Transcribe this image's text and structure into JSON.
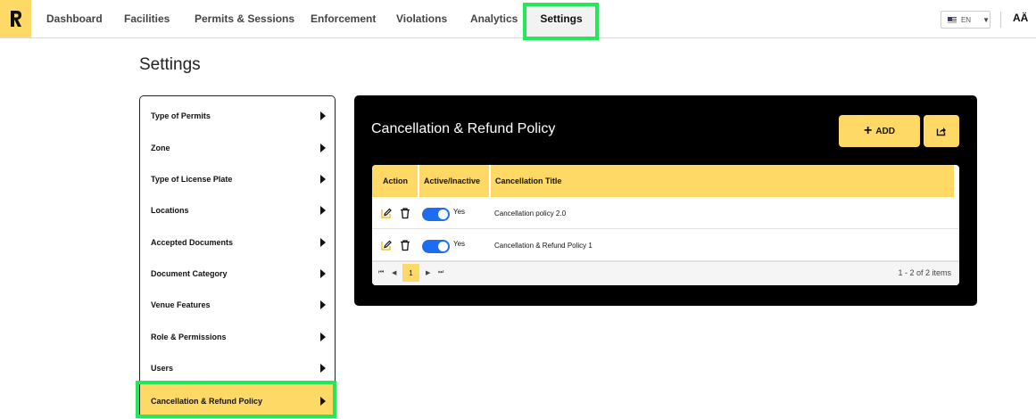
{
  "nav": {
    "items": [
      {
        "label": "Dashboard"
      },
      {
        "label": "Facilities"
      },
      {
        "label": "Permits & Sessions"
      },
      {
        "label": "Enforcement"
      },
      {
        "label": "Violations"
      },
      {
        "label": "Analytics"
      },
      {
        "label": "Settings",
        "active": true
      }
    ],
    "language": "EN",
    "font_size_label": "AÄ"
  },
  "page": {
    "title": "Settings"
  },
  "sidebar": {
    "items": [
      {
        "label": "Type of Permits"
      },
      {
        "label": "Zone"
      },
      {
        "label": "Type of License Plate"
      },
      {
        "label": "Locations"
      },
      {
        "label": "Accepted Documents"
      },
      {
        "label": "Document Category"
      },
      {
        "label": "Venue Features"
      },
      {
        "label": "Role & Permissions"
      },
      {
        "label": "Users"
      },
      {
        "label": "Cancellation & Refund Policy",
        "active": true
      }
    ]
  },
  "panel": {
    "title": "Cancellation & Refund Policy",
    "add_label": "ADD",
    "table": {
      "columns": [
        "Action",
        "Active/Inactive",
        "Cancellation Title"
      ],
      "rows": [
        {
          "active_label": "Yes",
          "title": "Cancellation policy 2.0"
        },
        {
          "active_label": "Yes",
          "title": "Cancellation & Refund Policy 1"
        }
      ]
    },
    "pager": {
      "current_page": "1",
      "info": "1 - 2 of 2 items"
    }
  },
  "colors": {
    "accent": "#ffd966",
    "toggle": "#1e6cf0",
    "highlight": "#22e85a"
  }
}
